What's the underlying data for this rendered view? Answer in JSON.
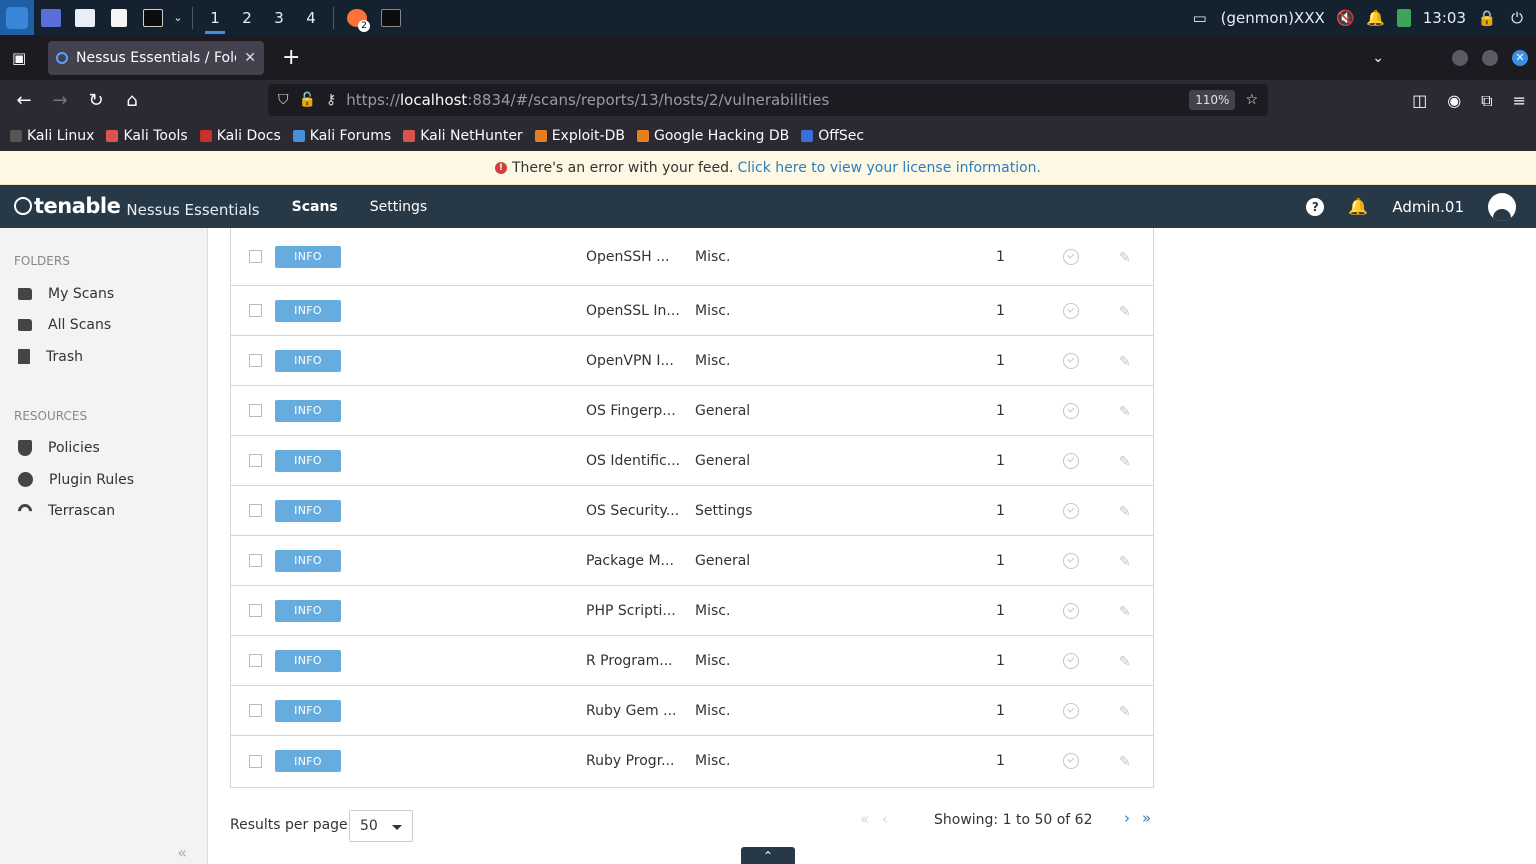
{
  "os": {
    "workspaces": [
      "1",
      "2",
      "3",
      "4"
    ],
    "genmon": "(genmon)XXX",
    "clock": "13:03",
    "firefox_badge": "2"
  },
  "browser": {
    "tab_title": "Nessus Essentials / Folder",
    "url_prefix": "https://",
    "url_host": "localhost",
    "url_rest": ":8834/#/scans/reports/13/hosts/2/vulnerabilities",
    "zoom": "110%",
    "bookmarks": [
      {
        "label": "Kali Linux",
        "color": "#555"
      },
      {
        "label": "Kali Tools",
        "color": "#d9534f"
      },
      {
        "label": "Kali Docs",
        "color": "#c9302c"
      },
      {
        "label": "Kali Forums",
        "color": "#4a90d9"
      },
      {
        "label": "Kali NetHunter",
        "color": "#d9534f"
      },
      {
        "label": "Exploit-DB",
        "color": "#e67e22"
      },
      {
        "label": "Google Hacking DB",
        "color": "#e67e22"
      },
      {
        "label": "OffSec",
        "color": "#3a6fd8"
      }
    ]
  },
  "notice": {
    "text": "There's an error with your feed.",
    "link": "Click here to view your license information."
  },
  "header": {
    "brand": "tenable",
    "product": "Nessus Essentials",
    "nav": [
      "Scans",
      "Settings"
    ],
    "user": "Admin.01"
  },
  "sidebar": {
    "folders_title": "FOLDERS",
    "folders": [
      {
        "label": "My Scans",
        "icon": "folder-icon"
      },
      {
        "label": "All Scans",
        "icon": "folder-icon"
      },
      {
        "label": "Trash",
        "icon": "trash-icon"
      }
    ],
    "resources_title": "RESOURCES",
    "resources": [
      {
        "label": "Policies",
        "icon": "shield-icon"
      },
      {
        "label": "Plugin Rules",
        "icon": "plug-icon"
      },
      {
        "label": "Terrascan",
        "icon": "wave-icon"
      }
    ]
  },
  "vulns": [
    {
      "severity": "INFO",
      "name": "OpenSSH ...",
      "family": "Misc.",
      "count": "1"
    },
    {
      "severity": "INFO",
      "name": "OpenSSL In...",
      "family": "Misc.",
      "count": "1"
    },
    {
      "severity": "INFO",
      "name": "OpenVPN I...",
      "family": "Misc.",
      "count": "1"
    },
    {
      "severity": "INFO",
      "name": "OS Fingerp...",
      "family": "General",
      "count": "1"
    },
    {
      "severity": "INFO",
      "name": "OS Identific...",
      "family": "General",
      "count": "1"
    },
    {
      "severity": "INFO",
      "name": "OS Security...",
      "family": "Settings",
      "count": "1"
    },
    {
      "severity": "INFO",
      "name": "Package M...",
      "family": "General",
      "count": "1"
    },
    {
      "severity": "INFO",
      "name": "PHP Scripti...",
      "family": "Misc.",
      "count": "1"
    },
    {
      "severity": "INFO",
      "name": "R Program...",
      "family": "Misc.",
      "count": "1"
    },
    {
      "severity": "INFO",
      "name": "Ruby Gem ...",
      "family": "Misc.",
      "count": "1"
    },
    {
      "severity": "INFO",
      "name": "Ruby Progr...",
      "family": "Misc.",
      "count": "1"
    }
  ],
  "footer": {
    "results_label": "Results per page",
    "per_page": "50",
    "showing": "Showing: 1 to 50 of 62",
    "first": "«",
    "prev": "‹",
    "next": "›",
    "last": "»"
  },
  "colors": {
    "header_bg": "#273846",
    "info_badge": "#67acdf",
    "link": "#2d7dbd"
  }
}
